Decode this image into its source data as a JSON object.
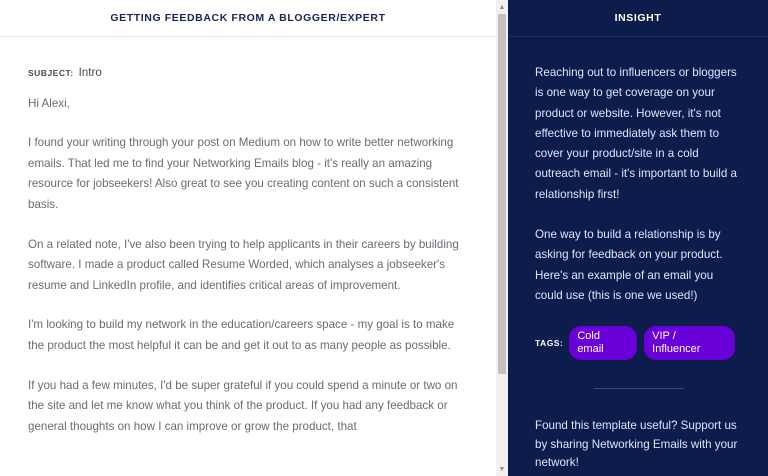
{
  "email_panel": {
    "title": "GETTING FEEDBACK FROM A BLOGGER/EXPERT",
    "subject_label": "SUBJECT:",
    "subject": "Intro",
    "greeting": "Hi Alexi,",
    "paragraphs": [
      "I found your writing through your post on Medium on how to write better networking emails. That led me to find your Networking Emails blog - it's really an amazing resource for jobseekers! Also great to see you creating content on such a consistent basis.",
      "On a related note, I've also been trying to help applicants in their careers by building software. I made a product called Resume Worded, which analyses a jobseeker's resume and LinkedIn profile, and identifies critical areas of improvement.",
      "I'm looking to build my network in the education/careers space - my goal is to make the product the most helpful it can be and get it out to as many people as possible.",
      "If you had a few minutes, I'd be super grateful if you could spend a minute or two on the site and let me know what you think of the product. If you had any feedback or general thoughts on how I can improve or grow the product, that"
    ]
  },
  "insight_panel": {
    "title": "INSIGHT",
    "paragraphs": [
      "Reaching out to influencers or bloggers is one way to get coverage on your product or website. However, it's not effective to immediately ask them to cover your product/site in a cold outreach email - it's important to build a relationship first!",
      "One way to build a relationship is by asking for feedback on your product. Here's an example of an email you could use (this is one we used!)"
    ],
    "tags_label": "TAGS:",
    "tags": [
      "Cold email",
      "VIP / Influencer"
    ],
    "cta": "Found this template useful? Support us by sharing Networking Emails with your network!"
  },
  "colors": {
    "sidebar_bg": "#0d1d4b",
    "tag_bg": "#6a00d8",
    "title_text": "#1b2553"
  },
  "icons": {
    "scroll_up": "scroll-up-arrow-icon",
    "scroll_down": "scroll-down-arrow-icon"
  }
}
